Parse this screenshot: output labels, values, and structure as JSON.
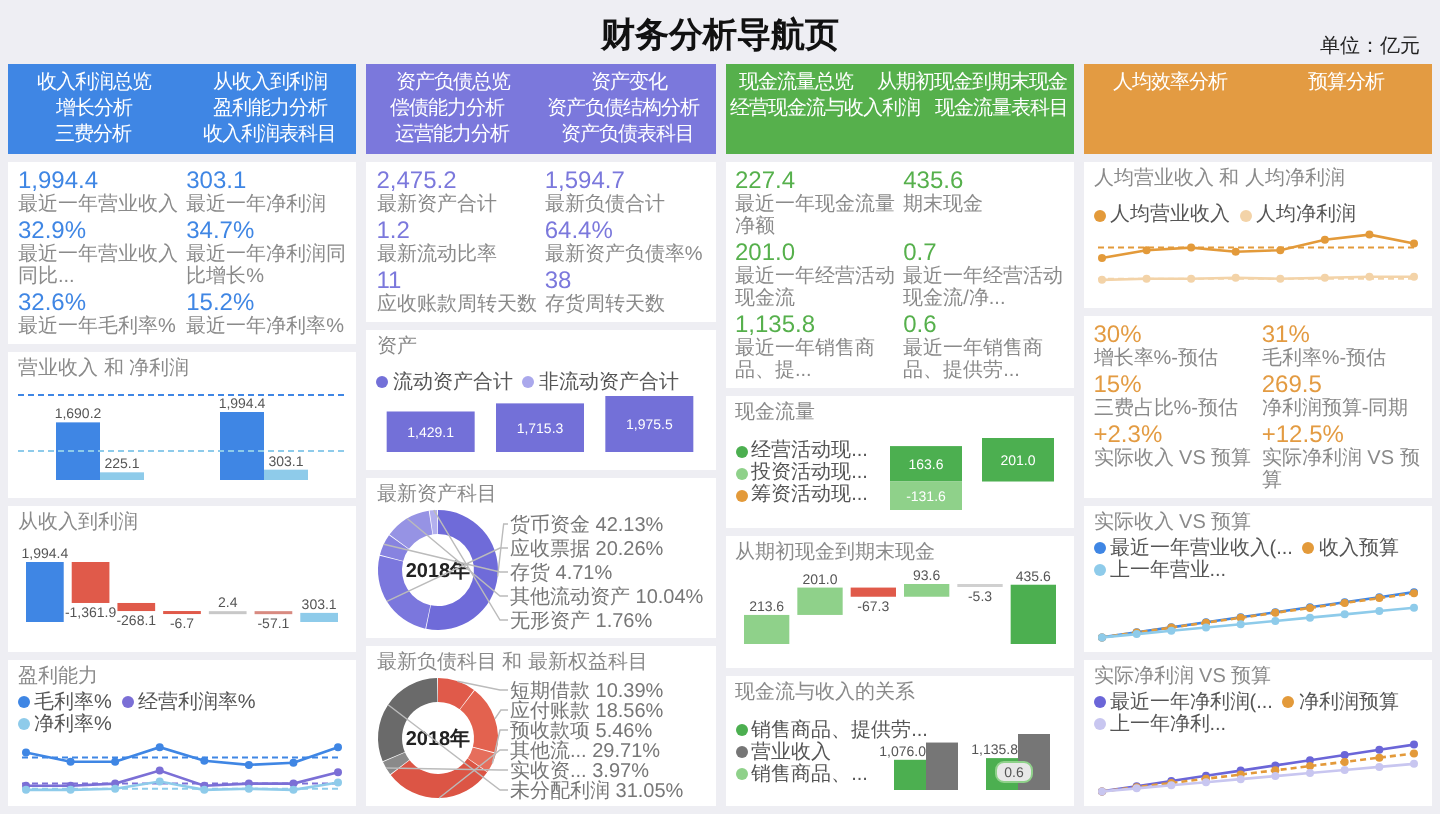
{
  "title": "财务分析导航页",
  "unit": "单位：亿元",
  "columns": [
    {
      "color": "#3f86e4",
      "nav": [
        "收入利润总览",
        "从收入到利润",
        "增长分析",
        "盈利能力分析",
        "三费分析",
        "收入利润表科目"
      ],
      "panels": [
        {
          "kind": "kpi",
          "items": [
            {
              "value": "1,994.4",
              "label": "最近一年营业收入"
            },
            {
              "value": "303.1",
              "label": "最近一年净利润"
            },
            {
              "value": "32.9%",
              "label": "最近一年营业收入同比..."
            },
            {
              "value": "34.7%",
              "label": "最近一年净利润同比增长%"
            },
            {
              "value": "32.6%",
              "label": "最近一年毛利率%"
            },
            {
              "value": "15.2%",
              "label": "最近一年净利率%"
            }
          ]
        },
        {
          "kind": "bars",
          "title": "营业收入 和 净利润",
          "chart_data": {
            "type": "bar",
            "categories": [
              null,
              null
            ],
            "series": [
              {
                "color": "#3f86e4",
                "values": [
                  1690.2,
                  1994.4
                ],
                "value_labels": [
                  "1,690.2",
                  "1,994.4"
                ]
              },
              {
                "color": "#8ecbea",
                "values": [
                  225.1,
                  303.1
                ],
                "value_labels": [
                  "225.1",
                  "303.1"
                ]
              }
            ],
            "data_labels": true
          }
        },
        {
          "kind": "waterfall",
          "title": "从收入到利润",
          "steps": [
            {
              "label": "1,994.4",
              "color": "#3f86e4"
            },
            {
              "label": "-1,361.9",
              "color": "#e05a4a"
            },
            {
              "label": "-268.1",
              "color": "#e05a4a"
            },
            {
              "label": "-6.7",
              "color": "#e05a4a"
            },
            {
              "label": "2.4",
              "color": "#c8c8c8"
            },
            {
              "label": "-57.1",
              "color": "#d88a80"
            },
            {
              "label": "303.1",
              "color": "#8ecbea"
            }
          ]
        },
        {
          "kind": "lines",
          "title": "盈利能力",
          "legend": [
            {
              "label": "毛利率%",
              "color": "#3f86e4"
            },
            {
              "label": "经营利润率%",
              "color": "#7b6fd6"
            },
            {
              "label": "净利率%",
              "color": "#8ecbea"
            }
          ]
        }
      ]
    },
    {
      "color": "#7b78dc",
      "nav": [
        "资产负债总览",
        "资产变化",
        "偿债能力分析",
        "资产负债结构分析",
        "运营能力分析",
        "资产负债表科目"
      ],
      "panels": [
        {
          "kind": "kpi",
          "items": [
            {
              "value": "2,475.2",
              "label": "最新资产合计"
            },
            {
              "value": "1,594.7",
              "label": "最新负债合计"
            },
            {
              "value": "1.2",
              "label": "最新流动比率"
            },
            {
              "value": "64.4%",
              "label": "最新资产负债率%"
            },
            {
              "value": "11",
              "label": "应收账款周转天数"
            },
            {
              "value": "38",
              "label": "存货周转天数"
            }
          ]
        },
        {
          "kind": "stack",
          "title": "资产",
          "chart_data": {
            "type": "bar",
            "stacked": true,
            "categories": [
              null,
              null,
              null
            ],
            "series": [
              {
                "name": "流动资产合计",
                "color": "#7370d8",
                "values": [
                  1429.1,
                  1715.3,
                  1975.5
                ],
                "value_labels": [
                  "1,429.1",
                  "1,715.3",
                  "1,975.5"
                ]
              },
              {
                "name": "非流动资产合计",
                "color": "#aaa8ec",
                "values": [
                  null,
                  null,
                  null
                ]
              }
            ],
            "data_labels": true
          }
        },
        {
          "kind": "donut",
          "title": "最新资产科目",
          "center_label": "2018年",
          "chart_data": {
            "type": "donut",
            "categories": [
              "货币资金",
              "应收票据",
              "存货",
              "其他流动资产",
              "无形资产"
            ],
            "values": [
              42.13,
              20.26,
              4.71,
              10.04,
              1.76
            ],
            "value_labels": [
              "42.13%",
              "20.26%",
              "4.71%",
              "10.04%",
              "1.76%"
            ],
            "colors": [
              "#6f6bd9",
              "#7b77dd",
              "#8783e0",
              "#9693e4",
              "#b3b0ee"
            ],
            "data_labels": true
          }
        },
        {
          "kind": "donut",
          "title": "最新负债科目 和 最新权益科目",
          "center_label": "2018年",
          "chart_data": {
            "type": "donut",
            "categories": [
              "短期借款",
              "应付账款",
              "预收款项",
              "其他流...",
              "实收资...",
              "未分配利润"
            ],
            "values": [
              10.39,
              18.56,
              5.46,
              29.71,
              3.97,
              31.05
            ],
            "value_labels": [
              "10.39%",
              "18.56%",
              "5.46%",
              "29.71%",
              "3.97%",
              "31.05%"
            ],
            "colors": [
              "#e05a4a",
              "#e3624f",
              "#e66e5c",
              "#dc5545",
              "#8a8a8a",
              "#6a6a6a"
            ],
            "data_labels": true
          }
        }
      ]
    },
    {
      "color": "#56b04c",
      "nav": [
        "现金流量总览",
        "从期初现金到期末现金",
        "经营现金流与收入利润",
        "现金流量表科目"
      ],
      "panels": [
        {
          "kind": "kpi",
          "items": [
            {
              "value": "227.4",
              "label": "最近一年现金流量净额"
            },
            {
              "value": "435.6",
              "label": "期末现金"
            },
            {
              "value": "201.0",
              "label": "最近一年经营活动现金流"
            },
            {
              "value": "0.7",
              "label": "最近一年经营活动现金流/净..."
            },
            {
              "value": "1,135.8",
              "label": "最近一年销售商品、提..."
            },
            {
              "value": "0.6",
              "label": "最近一年销售商品、提供劳..."
            }
          ]
        },
        {
          "kind": "diverging",
          "title": "现金流量",
          "chart_data": {
            "type": "bar",
            "stacked": true,
            "categories": [
              null,
              null
            ],
            "series": [
              {
                "name": "经营活动现...",
                "color": "#4caf50",
                "values": [
                  163.6,
                  201.0
                ],
                "value_labels": [
                  "163.6",
                  "201.0"
                ]
              },
              {
                "name": "投资活动现...",
                "color": "#8fd18a",
                "values": [
                  -131.6,
                  null
                ],
                "value_labels": [
                  "-131.6",
                  null
                ]
              },
              {
                "name": "筹资活动现...",
                "color": "#e39a3a",
                "values": [
                  null,
                  null
                ]
              }
            ],
            "data_labels": true
          }
        },
        {
          "kind": "waterfall",
          "title": "从期初现金到期末现金",
          "steps": [
            {
              "label": "213.6",
              "color": "#8fd18a"
            },
            {
              "label": "201.0",
              "color": "#8fd18a"
            },
            {
              "label": "-67.3",
              "color": "#e05a4a"
            },
            {
              "label": "93.6",
              "color": "#8fd18a"
            },
            {
              "label": "-5.3",
              "color": "#d0d0d0"
            },
            {
              "label": "435.6",
              "color": "#4caf50"
            }
          ]
        },
        {
          "kind": "combo",
          "title": "现金流与收入的关系",
          "legend": [
            {
              "label": "销售商品、提供劳...",
              "color": "#4caf50"
            },
            {
              "label": "营业收入",
              "color": "#767676"
            },
            {
              "label": "销售商品、...",
              "color": "#8fd18a"
            }
          ],
          "badge": "0.6",
          "chart_data": {
            "type": "bar",
            "categories": [
              null,
              null
            ],
            "series": [
              {
                "type": "bar",
                "color": "#4caf50",
                "values": [
                  1076.0,
                  1135.8
                ],
                "value_labels": [
                  "1,076.0",
                  "1,135.8"
                ]
              },
              {
                "type": "bar",
                "color": "#767676",
                "values": [
                  1690.2,
                  1994.4
                ],
                "value_labels": [
                  null,
                  null
                ]
              }
            ],
            "data_labels": true
          }
        }
      ]
    },
    {
      "color": "#e39b42",
      "nav": [
        "人均效率分析",
        "预算分析"
      ],
      "panels": [
        {
          "kind": "lines",
          "title": "人均营业收入 和 人均净利润",
          "legend": [
            {
              "label": "人均营业收入",
              "color": "#e39a3a"
            },
            {
              "label": "人均净利润",
              "color": "#f3d3a8"
            }
          ]
        },
        {
          "kind": "kpi",
          "items": [
            {
              "value": "30%",
              "label": "增长率%-预估"
            },
            {
              "value": "31%",
              "label": "毛利率%-预估"
            },
            {
              "value": "15%",
              "label": "三费占比%-预估"
            },
            {
              "value": "269.5",
              "label": "净利润预算-同期"
            },
            {
              "value": "+2.3%",
              "label": "实际收入 VS 预算"
            },
            {
              "value": "+12.5%",
              "label": "实际净利润 VS 预算"
            }
          ]
        },
        {
          "kind": "lines",
          "title": "实际收入 VS 预算",
          "legend": [
            {
              "label": "最近一年营业收入(...",
              "color": "#3f86e4"
            },
            {
              "label": "收入预算",
              "color": "#e39a3a"
            },
            {
              "label": "上一年营业...",
              "color": "#8ecbea"
            }
          ]
        },
        {
          "kind": "lines",
          "title": "实际净利润 VS 预算",
          "legend": [
            {
              "label": "最近一年净利润(...",
              "color": "#6b66d8"
            },
            {
              "label": "净利润预算",
              "color": "#e39a3a"
            },
            {
              "label": "上一年净利...",
              "color": "#c8c6f0"
            }
          ]
        }
      ]
    }
  ]
}
